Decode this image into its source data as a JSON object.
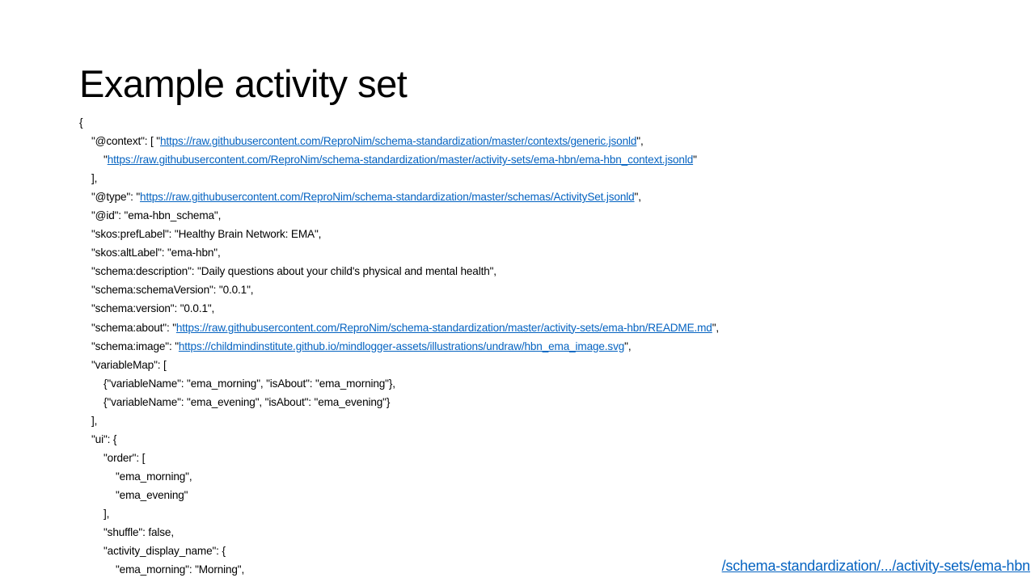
{
  "slide": {
    "title": "Example activity set",
    "footer_link": "/schema-standardization/.../activity-sets/ema-hbn"
  },
  "code": {
    "open_brace": "{",
    "context_key": "\"@context\": [ \"",
    "context_url_1": "https://raw.githubusercontent.com/ReproNim/schema-standardization/master/contexts/generic.jsonld",
    "context_sep_1": "\",",
    "context_quote_2": "\"",
    "context_url_2": "https://raw.githubusercontent.com/ReproNim/schema-standardization/master/activity-sets/ema-hbn/ema-hbn_context.jsonld",
    "context_end_2": "\"",
    "context_close": "],",
    "type_key": "\"@type\": \"",
    "type_url": "https://raw.githubusercontent.com/ReproNim/schema-standardization/master/schemas/ActivitySet.jsonld",
    "type_end": "\",",
    "id_line": "\"@id\": \"ema-hbn_schema\",",
    "preflabel_line": "\"skos:prefLabel\": \"Healthy Brain Network: EMA\",",
    "altlabel_line": "\"skos:altLabel\": \"ema-hbn\",",
    "description_line": "\"schema:description\": \"Daily questions about your child's physical and mental health\",",
    "schemaversion_line": "\"schema:schemaVersion\": \"0.0.1\",",
    "version_line": "\"schema:version\": \"0.0.1\",",
    "about_key": "\"schema:about\": \"",
    "about_url": "https://raw.githubusercontent.com/ReproNim/schema-standardization/master/activity-sets/ema-hbn/README.md",
    "about_end": "\",",
    "image_key": "\"schema:image\": \"",
    "image_url": "https://childmindinstitute.github.io/mindlogger-assets/illustrations/undraw/hbn_ema_image.svg",
    "image_end": "\",",
    "variablemap_open": "\"variableMap\": [",
    "variablemap_items": [
      "{\"variableName\": \"ema_morning\", \"isAbout\": \"ema_morning\"},",
      "{\"variableName\": \"ema_evening\", \"isAbout\": \"ema_evening\"}"
    ],
    "variablemap_close": "],",
    "ui_open": "\"ui\": {",
    "order_open": "\"order\": [",
    "order_items": [
      "\"ema_morning\",",
      "\"ema_evening\""
    ],
    "order_close": "],",
    "shuffle_line": "\"shuffle\": false,",
    "display_name_open": "\"activity_display_name\": {",
    "display_name_items": [
      "\"ema_morning\":  \"Morning\","
    ]
  }
}
